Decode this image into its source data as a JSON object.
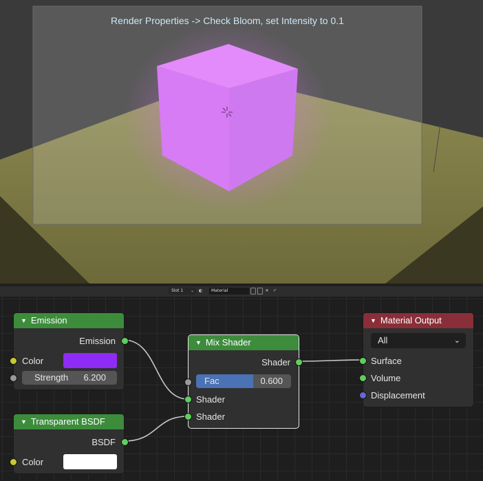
{
  "viewport": {
    "overlay_text": "Render Properties -> Check Bloom, set Intensity to 0.1"
  },
  "header": {
    "slot": "Slot 1",
    "material_name": "Material"
  },
  "nodes": {
    "emission": {
      "title": "Emission",
      "output": "Emission",
      "color_label": "Color",
      "color_value": "#8e2cf5",
      "strength_label": "Strength",
      "strength_value": "6.200"
    },
    "transparent": {
      "title": "Transparent BSDF",
      "output": "BSDF",
      "color_label": "Color",
      "color_value": "#ffffff"
    },
    "mix": {
      "title": "Mix Shader",
      "output": "Shader",
      "fac_label": "Fac",
      "fac_value": "0.600",
      "fac_fraction": 0.6,
      "input1": "Shader",
      "input2": "Shader"
    },
    "output": {
      "title": "Material Output",
      "target": "All",
      "surface": "Surface",
      "volume": "Volume",
      "displacement": "Displacement"
    }
  },
  "colors": {
    "header_green": "#3c8c3c",
    "header_red": "#8a2f39",
    "socket_shader": "#5ecf5e",
    "socket_color": "#c9c92d",
    "socket_float": "#9a9a9a",
    "socket_vector": "#6666d6",
    "fac_fill": "#4a72b5"
  }
}
